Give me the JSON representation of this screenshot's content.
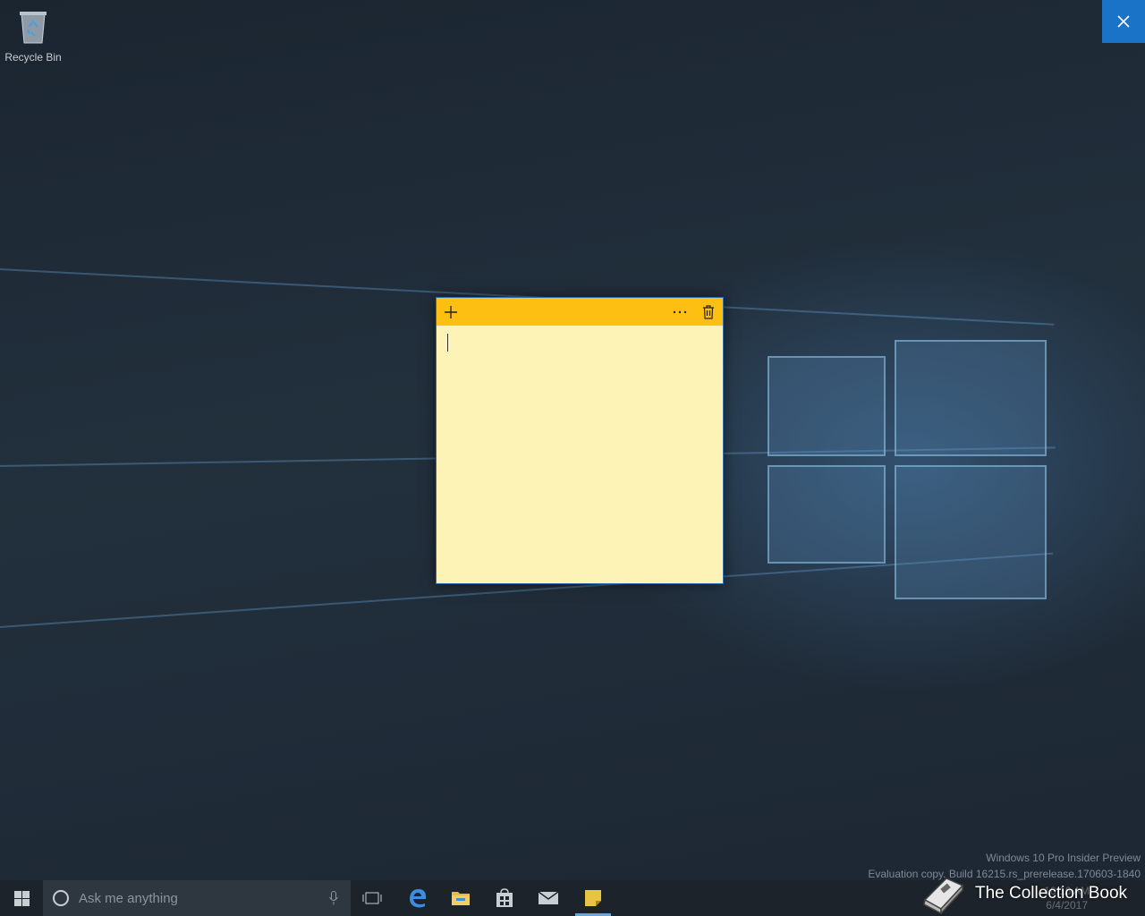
{
  "desktop": {
    "recycle_bin_label": "Recycle Bin",
    "watermark_line1": "Windows 10 Pro Insider Preview",
    "watermark_line2": "Evaluation copy. Build 16215.rs_prerelease.170603-1840"
  },
  "window_controls": {
    "close_icon": "close-icon"
  },
  "sticky_note": {
    "color_header": "#fcbf12",
    "color_body": "#fef3b6",
    "add_icon": "plus-icon",
    "menu_icon": "more-icon",
    "delete_icon": "trash-icon",
    "text": ""
  },
  "taskbar": {
    "search_placeholder": "Ask me anything",
    "pinned": [
      "start",
      "search",
      "task-view",
      "edge",
      "file-explorer",
      "store",
      "mail",
      "sticky-notes"
    ],
    "active_app": "sticky-notes",
    "tray_time": "10:16 AM",
    "tray_date": "6/4/2017"
  },
  "overlay_logo": {
    "label": "The Collection Book"
  },
  "colors": {
    "accent": "#1a73c7",
    "taskbar": "#1c232b"
  }
}
